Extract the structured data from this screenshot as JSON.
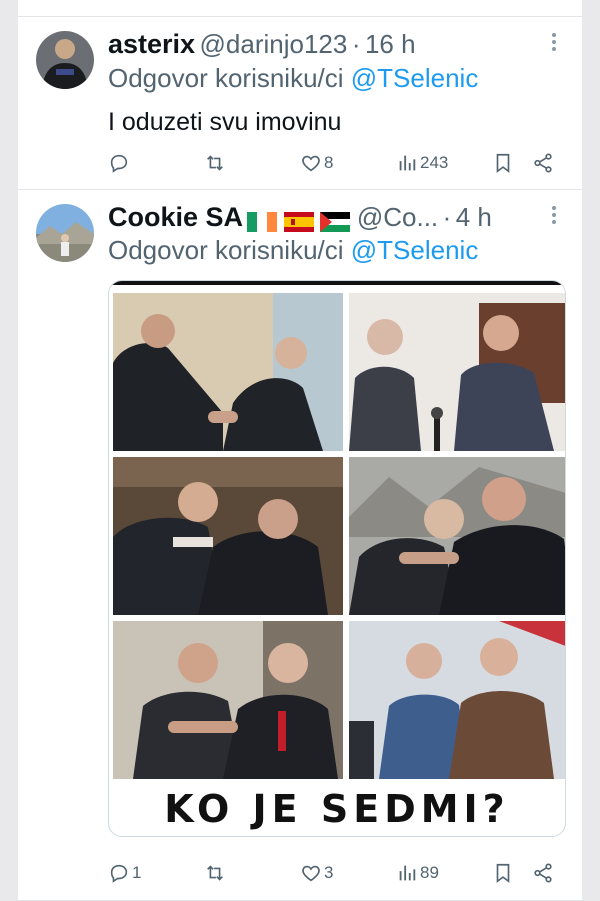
{
  "tweets": [
    {
      "name": "asterix",
      "handle": "@darinjo123",
      "separator": "·",
      "time": "16 h",
      "reply_prefix": "Odgovor korisniku/ci",
      "reply_to": "@TSelenic",
      "text": "I oduzeti svu imovinu",
      "stats": {
        "replies": "",
        "reposts": "",
        "likes": "8",
        "views": "243"
      }
    },
    {
      "name": "Cookie SA",
      "handle": "@Co...",
      "separator": "·",
      "time": "4 h",
      "reply_prefix": "Odgovor korisniku/ci",
      "reply_to": "@TSelenic",
      "flags": [
        "Ireland",
        "Spain",
        "Palestine"
      ],
      "media_caption": "KO JE SEDMI?",
      "stats": {
        "replies": "1",
        "reposts": "",
        "likes": "3",
        "views": "89"
      }
    }
  ],
  "icons": {
    "more": "more-vertical-icon",
    "reply": "reply-icon",
    "repost": "repost-icon",
    "like": "heart-icon",
    "views": "views-icon",
    "bookmark": "bookmark-icon",
    "share": "share-icon"
  },
  "colors": {
    "link": "#1d9bf0",
    "muted": "#536471",
    "text": "#0f1419"
  }
}
